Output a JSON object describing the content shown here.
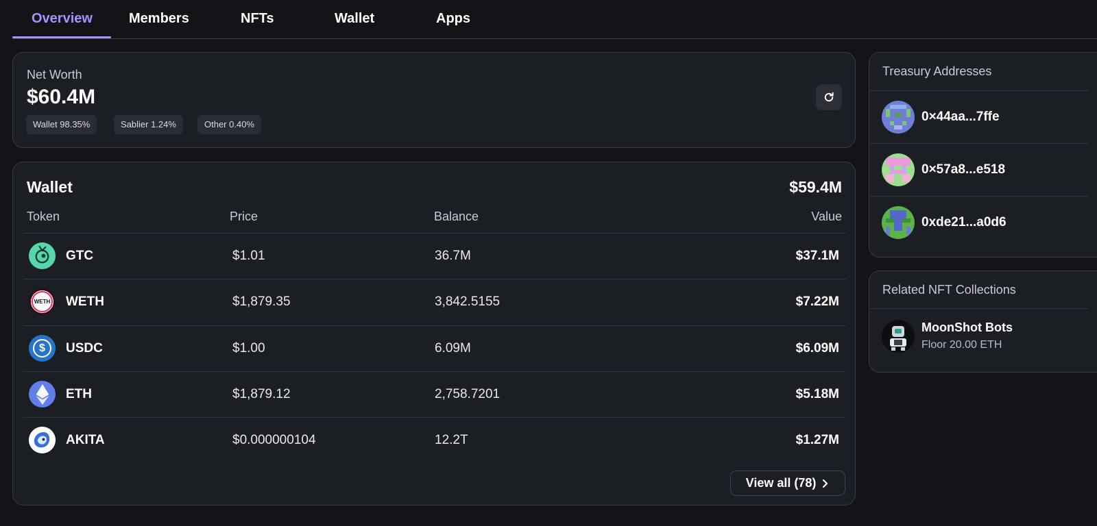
{
  "tabs": [
    {
      "label": "Overview",
      "active": true
    },
    {
      "label": "Members"
    },
    {
      "label": "NFTs"
    },
    {
      "label": "Wallet"
    },
    {
      "label": "Apps"
    }
  ],
  "net_worth": {
    "label": "Net Worth",
    "value": "$60.4M",
    "chips": [
      "Wallet 98.35%",
      "Sablier 1.24%",
      "Other 0.40%"
    ],
    "refresh_icon": "refresh-icon"
  },
  "wallet": {
    "title": "Wallet",
    "total": "$59.4M",
    "columns": {
      "token": "Token",
      "price": "Price",
      "balance": "Balance",
      "value": "Value"
    },
    "rows": [
      {
        "symbol": "GTC",
        "price": "$1.01",
        "balance": "36.7M",
        "value": "$37.1M",
        "icon": "gtc-token-icon"
      },
      {
        "symbol": "WETH",
        "price": "$1,879.35",
        "balance": "3,842.5155",
        "value": "$7.22M",
        "icon": "weth-token-icon",
        "icon_text": "WETH"
      },
      {
        "symbol": "USDC",
        "price": "$1.00",
        "balance": "6.09M",
        "value": "$6.09M",
        "icon": "usdc-token-icon",
        "icon_text": "$"
      },
      {
        "symbol": "ETH",
        "price": "$1,879.12",
        "balance": "2,758.7201",
        "value": "$5.18M",
        "icon": "eth-token-icon"
      },
      {
        "symbol": "AKITA",
        "price": "$0.000000104",
        "balance": "12.2T",
        "value": "$1.27M",
        "icon": "akita-token-icon"
      }
    ],
    "view_all": "View all (78)"
  },
  "treasury": {
    "title": "Treasury Addresses",
    "addresses": [
      {
        "address": "0×44aa...7ffe"
      },
      {
        "address": "0×57a8...e518"
      },
      {
        "address": "0xde21...a0d6"
      }
    ]
  },
  "nft_collections": {
    "title": "Related NFT Collections",
    "items": [
      {
        "name": "MoonShot Bots",
        "floor": "Floor 20.00 ETH"
      }
    ]
  },
  "colors": {
    "accent": "#a594f9",
    "background": "#121418",
    "card": "#1b1e23"
  }
}
